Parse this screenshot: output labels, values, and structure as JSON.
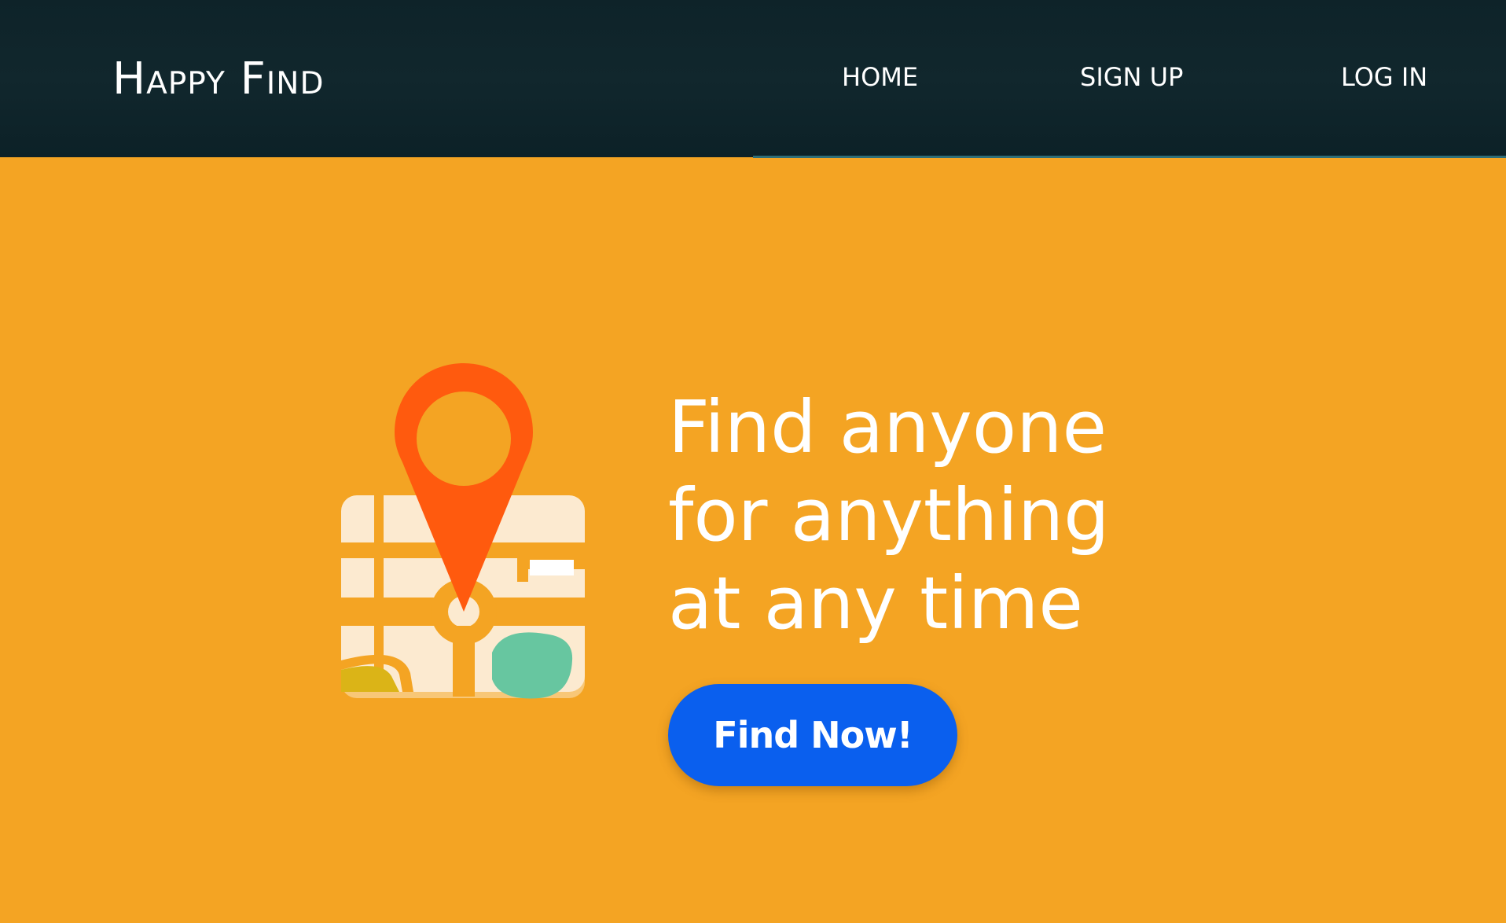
{
  "header": {
    "brand": "Happy Find",
    "nav": {
      "home": "HOME",
      "sign_up": "SIGN UP",
      "log_in": "LOG IN"
    }
  },
  "hero": {
    "icon": "map-pin-icon",
    "headline": {
      "line1": "Find anyone",
      "line2": "for anything",
      "line3": "at any time"
    },
    "cta_label": "Find Now!"
  },
  "colors": {
    "header_bg": "#0E2329",
    "page_bg": "#F4A423",
    "cta_bg": "#0A5FEE",
    "pin": "#FF5A0E",
    "map_base": "#FCEAD0",
    "map_park": "#67C6A0",
    "map_field": "#DBB417"
  }
}
